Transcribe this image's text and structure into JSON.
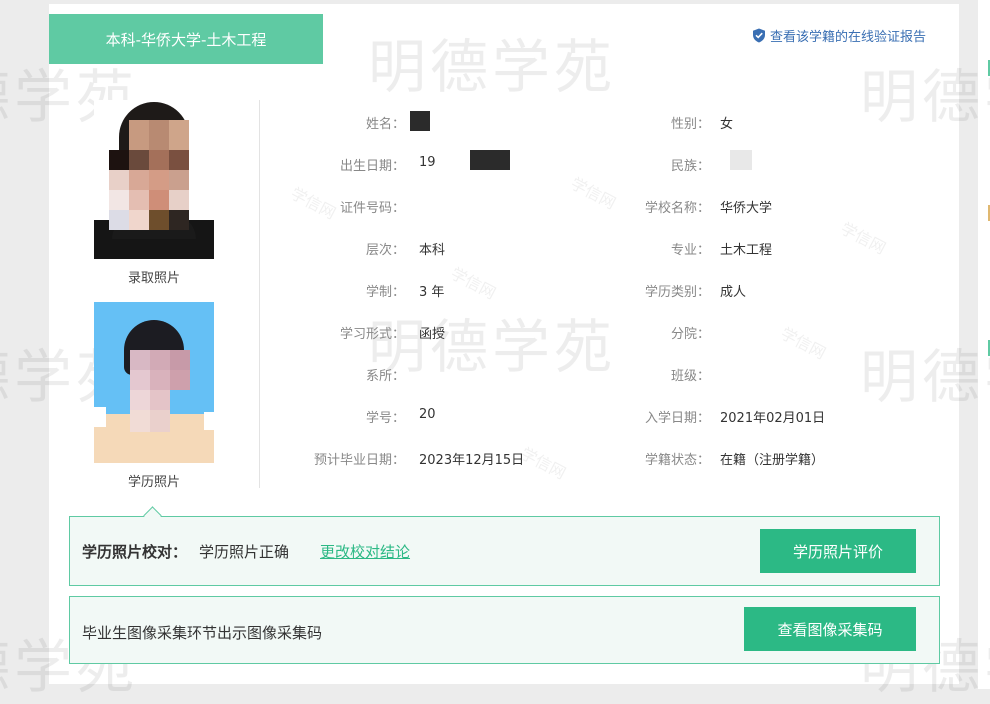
{
  "header": {
    "title_tab": "本科-华侨大学-土木工程",
    "verify_link": "查看该学籍的在线验证报告"
  },
  "photos": {
    "admission_caption": "录取照片",
    "degree_caption": "学历照片"
  },
  "fields_left": [
    {
      "label": "姓名：",
      "value": ""
    },
    {
      "label": "出生日期：",
      "value": "19"
    },
    {
      "label": "证件号码：",
      "value": ""
    },
    {
      "label": "层次：",
      "value": "本科"
    },
    {
      "label": "学制：",
      "value": "3 年"
    },
    {
      "label": "学习形式：",
      "value": "函授"
    },
    {
      "label": "系所：",
      "value": ""
    },
    {
      "label": "学号：",
      "value": "20"
    },
    {
      "label": "预计毕业日期：",
      "value": "2023年12月15日"
    }
  ],
  "fields_right": [
    {
      "label": "性别：",
      "value": "女"
    },
    {
      "label": "民族：",
      "value": ""
    },
    {
      "label": "学校名称：",
      "value": "华侨大学"
    },
    {
      "label": "专业：",
      "value": "土木工程"
    },
    {
      "label": "学历类别：",
      "value": "成人"
    },
    {
      "label": "分院：",
      "value": ""
    },
    {
      "label": "班级：",
      "value": ""
    },
    {
      "label": "入学日期：",
      "value": "2021年02月01日"
    },
    {
      "label": "学籍状态：",
      "value": "在籍（注册学籍）"
    }
  ],
  "check_panel": {
    "label": "学历照片校对：",
    "value": "学历照片正确",
    "link": "更改校对结论",
    "button": "学历照片评价"
  },
  "capture_panel": {
    "text": "毕业生图像采集环节出示图像采集码",
    "button": "查看图像采集码"
  },
  "watermarks": {
    "large": "明德学苑",
    "small": "学信网"
  },
  "colors": {
    "accent": "#5fcaa3",
    "button": "#2cb985",
    "link_blue": "#3a6fb3",
    "photo_bg_blue": "#65c0f5"
  },
  "icons": {
    "verify": "shield-check-icon"
  }
}
